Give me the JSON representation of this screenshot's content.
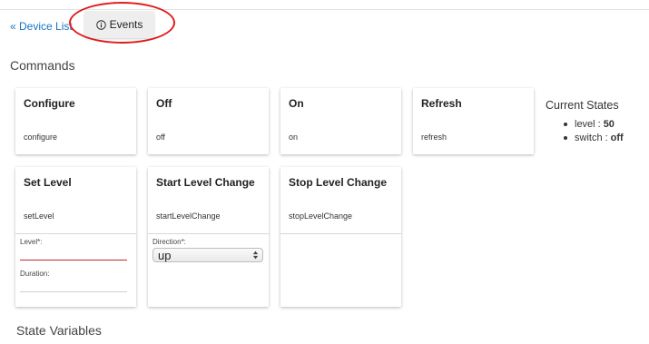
{
  "nav": {
    "back_label": "« Device List",
    "events_tab_label": "Events"
  },
  "commands_title": "Commands",
  "commands": [
    {
      "name": "Configure",
      "method": "configure"
    },
    {
      "name": "Off",
      "method": "off"
    },
    {
      "name": "On",
      "method": "on"
    },
    {
      "name": "Refresh",
      "method": "refresh"
    },
    {
      "name": "Set Level",
      "method": "setLevel",
      "params": [
        {
          "label": "Level*:",
          "value": ""
        },
        {
          "label": "Duration:",
          "value": ""
        }
      ]
    },
    {
      "name": "Start Level Change",
      "method": "startLevelChange",
      "params": [
        {
          "label": "Direction*:",
          "selected": "up"
        }
      ]
    },
    {
      "name": "Stop Level Change",
      "method": "stopLevelChange"
    }
  ],
  "current_states": {
    "title": "Current States",
    "items": [
      {
        "name": "level",
        "value": "50"
      },
      {
        "name": "switch",
        "value": "off"
      }
    ]
  },
  "state_variables_title": "State Variables",
  "colors": {
    "link": "#1a73c8",
    "highlight_ring": "#e01b1b",
    "active_input_underline": "#c62828"
  },
  "icons": {
    "events_tab": "info-circle-icon",
    "select": "up-down-arrows-icon"
  }
}
